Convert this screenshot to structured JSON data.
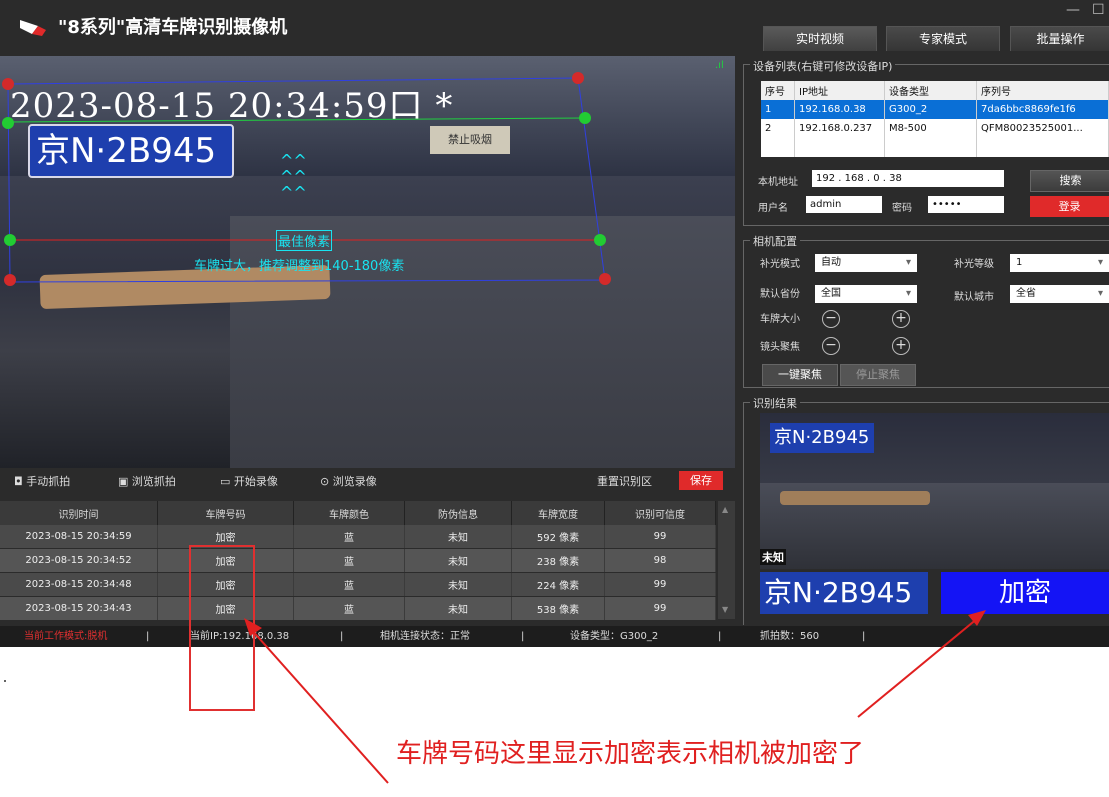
{
  "app": {
    "title": "\"8系列\"高清车牌识别摄像机"
  },
  "tabs": [
    {
      "label": "实时视频"
    },
    {
      "label": "专家模式"
    },
    {
      "label": "批量操作"
    }
  ],
  "video": {
    "osd_text": "2023-08-15  20:34:59口 *",
    "plate_text": "京N·2B945",
    "sign_text": "禁止吸烟",
    "best_pixel": "最佳像素",
    "advice": "车牌过大，推荐调整到140-180像素"
  },
  "toolbar": {
    "manual_capture": "手动抓拍",
    "browse_capture": "浏览抓拍",
    "start_record": "开始录像",
    "browse_record": "浏览录像",
    "reset_area": "重置识别区",
    "save": "保存"
  },
  "records": {
    "columns": [
      "识别时间",
      "车牌号码",
      "车牌颜色",
      "防伪信息",
      "车牌宽度",
      "识别可信度"
    ],
    "rows": [
      [
        "2023-08-15 20:34:59",
        "加密",
        "蓝",
        "未知",
        "592 像素",
        "99"
      ],
      [
        "2023-08-15 20:34:52",
        "加密",
        "蓝",
        "未知",
        "238 像素",
        "98"
      ],
      [
        "2023-08-15 20:34:48",
        "加密",
        "蓝",
        "未知",
        "224 像素",
        "99"
      ],
      [
        "2023-08-15 20:34:43",
        "加密",
        "蓝",
        "未知",
        "538 像素",
        "99"
      ]
    ]
  },
  "status": {
    "mode": "当前工作模式:脱机",
    "ip": "当前IP:192.168.0.38",
    "conn": "相机连接状态：正常",
    "devtype": "设备类型：G300_2",
    "count": "抓拍数：560"
  },
  "device_list": {
    "group_label": "设备列表(右键可修改设备IP)",
    "columns": [
      "序号",
      "IP地址",
      "设备类型",
      "序列号"
    ],
    "rows": [
      [
        "1",
        "192.168.0.38",
        "G300_2",
        "7da6bbc8869fe1f6"
      ],
      [
        "2",
        "192.168.0.237",
        "M8-500",
        "QFM80023525001..."
      ]
    ],
    "local_ip_label": "本机地址",
    "local_ip": "192 . 168 . 0 . 38",
    "user_label": "用户名",
    "user": "admin",
    "pwd_label": "密码",
    "pwd": "•••••",
    "search": "搜索",
    "login": "登录"
  },
  "camera_config": {
    "group_label": "相机配置",
    "fill_mode_label": "补光模式",
    "fill_mode": "自动",
    "fill_level_label": "补光等级",
    "fill_level": "1",
    "province_label": "默认省份",
    "province": "全国",
    "city_label": "默认城市",
    "city": "全省",
    "plate_size_label": "车牌大小",
    "focus_label": "镜头聚焦",
    "one_key_focus": "一键聚焦",
    "stop_focus": "停止聚焦"
  },
  "result": {
    "group_label": "识别结果",
    "unknown": "未知",
    "plate": "京N·2B945",
    "value": "加密"
  },
  "annotation": "车牌号码这里显示加密表示相机被加密了",
  "colors": {
    "accent_red": "#e02a2a",
    "plate_blue": "#1e3fae",
    "cyan": "#19e3f0",
    "select_blue": "#0a6fd6"
  }
}
